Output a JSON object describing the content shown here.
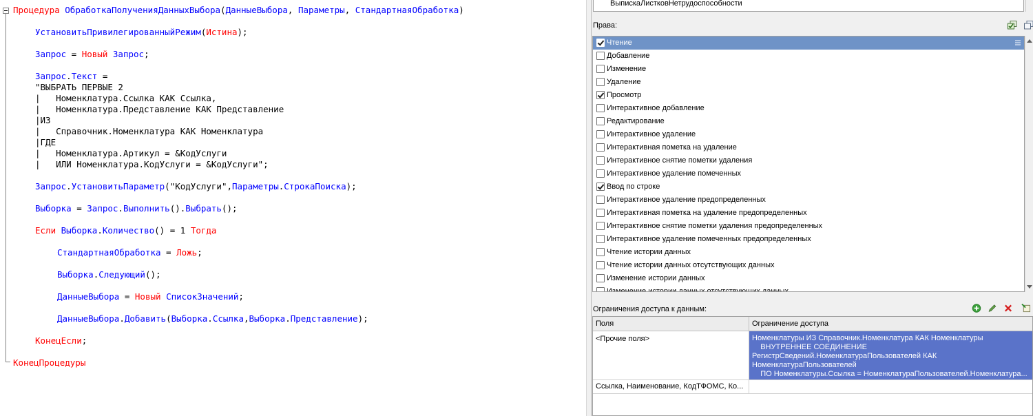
{
  "editor": {
    "lines": [
      {
        "y": 0,
        "indent": 0,
        "parts": [
          [
            "kw",
            "Процедура"
          ],
          [
            "pl",
            " "
          ],
          [
            "id",
            "ОбработкаПолученияДанныхВыбора"
          ],
          [
            "pl",
            "("
          ],
          [
            "id",
            "ДанныеВыбора"
          ],
          [
            "pl",
            ", "
          ],
          [
            "id",
            "Параметры"
          ],
          [
            "pl",
            ", "
          ],
          [
            "id",
            "СтандартнаяОбработка"
          ],
          [
            "pl",
            ")"
          ]
        ]
      },
      {
        "y": 2,
        "indent": 4,
        "parts": [
          [
            "id",
            "УстановитьПривилегированныйРежим"
          ],
          [
            "pl",
            "("
          ],
          [
            "kw",
            "Истина"
          ],
          [
            "pl",
            ");"
          ]
        ]
      },
      {
        "y": 4,
        "indent": 4,
        "parts": [
          [
            "id",
            "Запрос"
          ],
          [
            "pl",
            " = "
          ],
          [
            "kw",
            "Новый"
          ],
          [
            "pl",
            " "
          ],
          [
            "id",
            "Запрос"
          ],
          [
            "pl",
            ";"
          ]
        ]
      },
      {
        "y": 6,
        "indent": 4,
        "parts": [
          [
            "id",
            "Запрос"
          ],
          [
            "pl",
            "."
          ],
          [
            "id",
            "Текст"
          ],
          [
            "pl",
            " ="
          ]
        ]
      },
      {
        "y": 7,
        "indent": 4,
        "parts": [
          [
            "st",
            "\"ВЫБРАТЬ ПЕРВЫЕ 2"
          ]
        ]
      },
      {
        "y": 8,
        "indent": 4,
        "parts": [
          [
            "st",
            "|   Номенклатура.Ссылка КАК Ссылка,"
          ]
        ]
      },
      {
        "y": 9,
        "indent": 4,
        "parts": [
          [
            "st",
            "|   Номенклатура.Представление КАК Представление"
          ]
        ]
      },
      {
        "y": 10,
        "indent": 4,
        "parts": [
          [
            "st",
            "|ИЗ"
          ]
        ]
      },
      {
        "y": 11,
        "indent": 4,
        "parts": [
          [
            "st",
            "|   Справочник.Номенклатура КАК Номенклатура"
          ]
        ]
      },
      {
        "y": 12,
        "indent": 4,
        "parts": [
          [
            "st",
            "|ГДЕ"
          ]
        ]
      },
      {
        "y": 13,
        "indent": 4,
        "parts": [
          [
            "st",
            "|   Номенклатура.Артикул = &КодУслуги"
          ]
        ]
      },
      {
        "y": 14,
        "indent": 4,
        "parts": [
          [
            "st",
            "|   ИЛИ Номенклатура.КодУслуги = &КодУслуги\";"
          ]
        ]
      },
      {
        "y": 16,
        "indent": 4,
        "parts": [
          [
            "id",
            "Запрос"
          ],
          [
            "pl",
            "."
          ],
          [
            "id",
            "УстановитьПараметр"
          ],
          [
            "pl",
            "("
          ],
          [
            "st",
            "\"КодУслуги\""
          ],
          [
            "pl",
            ","
          ],
          [
            "id",
            "Параметры"
          ],
          [
            "pl",
            "."
          ],
          [
            "id",
            "СтрокаПоиска"
          ],
          [
            "pl",
            ");"
          ]
        ]
      },
      {
        "y": 18,
        "indent": 4,
        "parts": [
          [
            "id",
            "Выборка"
          ],
          [
            "pl",
            " = "
          ],
          [
            "id",
            "Запрос"
          ],
          [
            "pl",
            "."
          ],
          [
            "id",
            "Выполнить"
          ],
          [
            "pl",
            "()."
          ],
          [
            "id",
            "Выбрать"
          ],
          [
            "pl",
            "();"
          ]
        ]
      },
      {
        "y": 20,
        "indent": 4,
        "parts": [
          [
            "kw",
            "Если"
          ],
          [
            "pl",
            " "
          ],
          [
            "id",
            "Выборка"
          ],
          [
            "pl",
            "."
          ],
          [
            "id",
            "Количество"
          ],
          [
            "pl",
            "() = 1 "
          ],
          [
            "kw",
            "Тогда"
          ]
        ]
      },
      {
        "y": 22,
        "indent": 8,
        "parts": [
          [
            "id",
            "СтандартнаяОбработка"
          ],
          [
            "pl",
            " = "
          ],
          [
            "kw",
            "Ложь"
          ],
          [
            "pl",
            ";"
          ]
        ]
      },
      {
        "y": 24,
        "indent": 8,
        "parts": [
          [
            "id",
            "Выборка"
          ],
          [
            "pl",
            "."
          ],
          [
            "id",
            "Следующий"
          ],
          [
            "pl",
            "();"
          ]
        ]
      },
      {
        "y": 26,
        "indent": 8,
        "parts": [
          [
            "id",
            "ДанныеВыбора"
          ],
          [
            "pl",
            " = "
          ],
          [
            "kw",
            "Новый"
          ],
          [
            "pl",
            " "
          ],
          [
            "id",
            "СписокЗначений"
          ],
          [
            "pl",
            ";"
          ]
        ]
      },
      {
        "y": 28,
        "indent": 8,
        "parts": [
          [
            "id",
            "ДанныеВыбора"
          ],
          [
            "pl",
            "."
          ],
          [
            "id",
            "Добавить"
          ],
          [
            "pl",
            "("
          ],
          [
            "id",
            "Выборка"
          ],
          [
            "pl",
            "."
          ],
          [
            "id",
            "Ссылка"
          ],
          [
            "pl",
            ","
          ],
          [
            "id",
            "Выборка"
          ],
          [
            "pl",
            "."
          ],
          [
            "id",
            "Представление"
          ],
          [
            "pl",
            ");"
          ]
        ]
      },
      {
        "y": 30,
        "indent": 4,
        "parts": [
          [
            "kw",
            "КонецЕсли"
          ],
          [
            "pl",
            ";"
          ]
        ]
      },
      {
        "y": 32,
        "indent": 0,
        "parts": [
          [
            "kw",
            "КонецПроцедуры"
          ]
        ]
      }
    ]
  },
  "top_list": {
    "item": "ВыпискаЛистковНетрудоспособности"
  },
  "rights": {
    "label": "Права:",
    "items": [
      {
        "label": "Чтение",
        "checked": true,
        "selected": true
      },
      {
        "label": "Добавление",
        "checked": false
      },
      {
        "label": "Изменение",
        "checked": false
      },
      {
        "label": "Удаление",
        "checked": false
      },
      {
        "label": "Просмотр",
        "checked": true
      },
      {
        "label": "Интерактивное добавление",
        "checked": false
      },
      {
        "label": "Редактирование",
        "checked": false
      },
      {
        "label": "Интерактивное удаление",
        "checked": false
      },
      {
        "label": "Интерактивная пометка на удаление",
        "checked": false
      },
      {
        "label": "Интерактивное снятие пометки удаления",
        "checked": false
      },
      {
        "label": "Интерактивное удаление помеченных",
        "checked": false
      },
      {
        "label": "Ввод по строке",
        "checked": true
      },
      {
        "label": "Интерактивное удаление предопределенных",
        "checked": false
      },
      {
        "label": "Интерактивная пометка на удаление предопределенных",
        "checked": false
      },
      {
        "label": "Интерактивное снятие пометки удаления предопределенных",
        "checked": false
      },
      {
        "label": "Интерактивное удаление помеченных предопределенных",
        "checked": false
      },
      {
        "label": "Чтение истории данных",
        "checked": false
      },
      {
        "label": "Чтение истории данных отсутствующих данных",
        "checked": false
      },
      {
        "label": "Изменение истории данных",
        "checked": false
      },
      {
        "label": "Изменение истории данных отсутствующих данных",
        "checked": false
      }
    ]
  },
  "restrictions": {
    "label": "Ограничения доступа к данным:",
    "col_fields": "Поля",
    "col_restriction": "Ограничение доступа",
    "rows": [
      {
        "fields": "<Прочие поля>",
        "restriction_lines": [
          "Номенклатуры ИЗ Справочник.Номенклатура КАК Номенклатуры",
          "    ВНУТРЕННЕЕ СОЕДИНЕНИЕ",
          "РегистрСведений.НоменклатураПользователей КАК",
          "НоменклатураПользователей",
          "    ПО Номенклатуры.Ссылка = НоменклатураПользователей.Номенклатура..."
        ]
      },
      {
        "fields": "Ссылка, Наименование, КодТФОМС, Ко...",
        "restriction_lines": []
      }
    ]
  },
  "colors": {
    "keyword": "#ff0000",
    "identifier": "#0000ff",
    "selection": "#6f93c7",
    "restriction_selection": "#5a73c9"
  }
}
